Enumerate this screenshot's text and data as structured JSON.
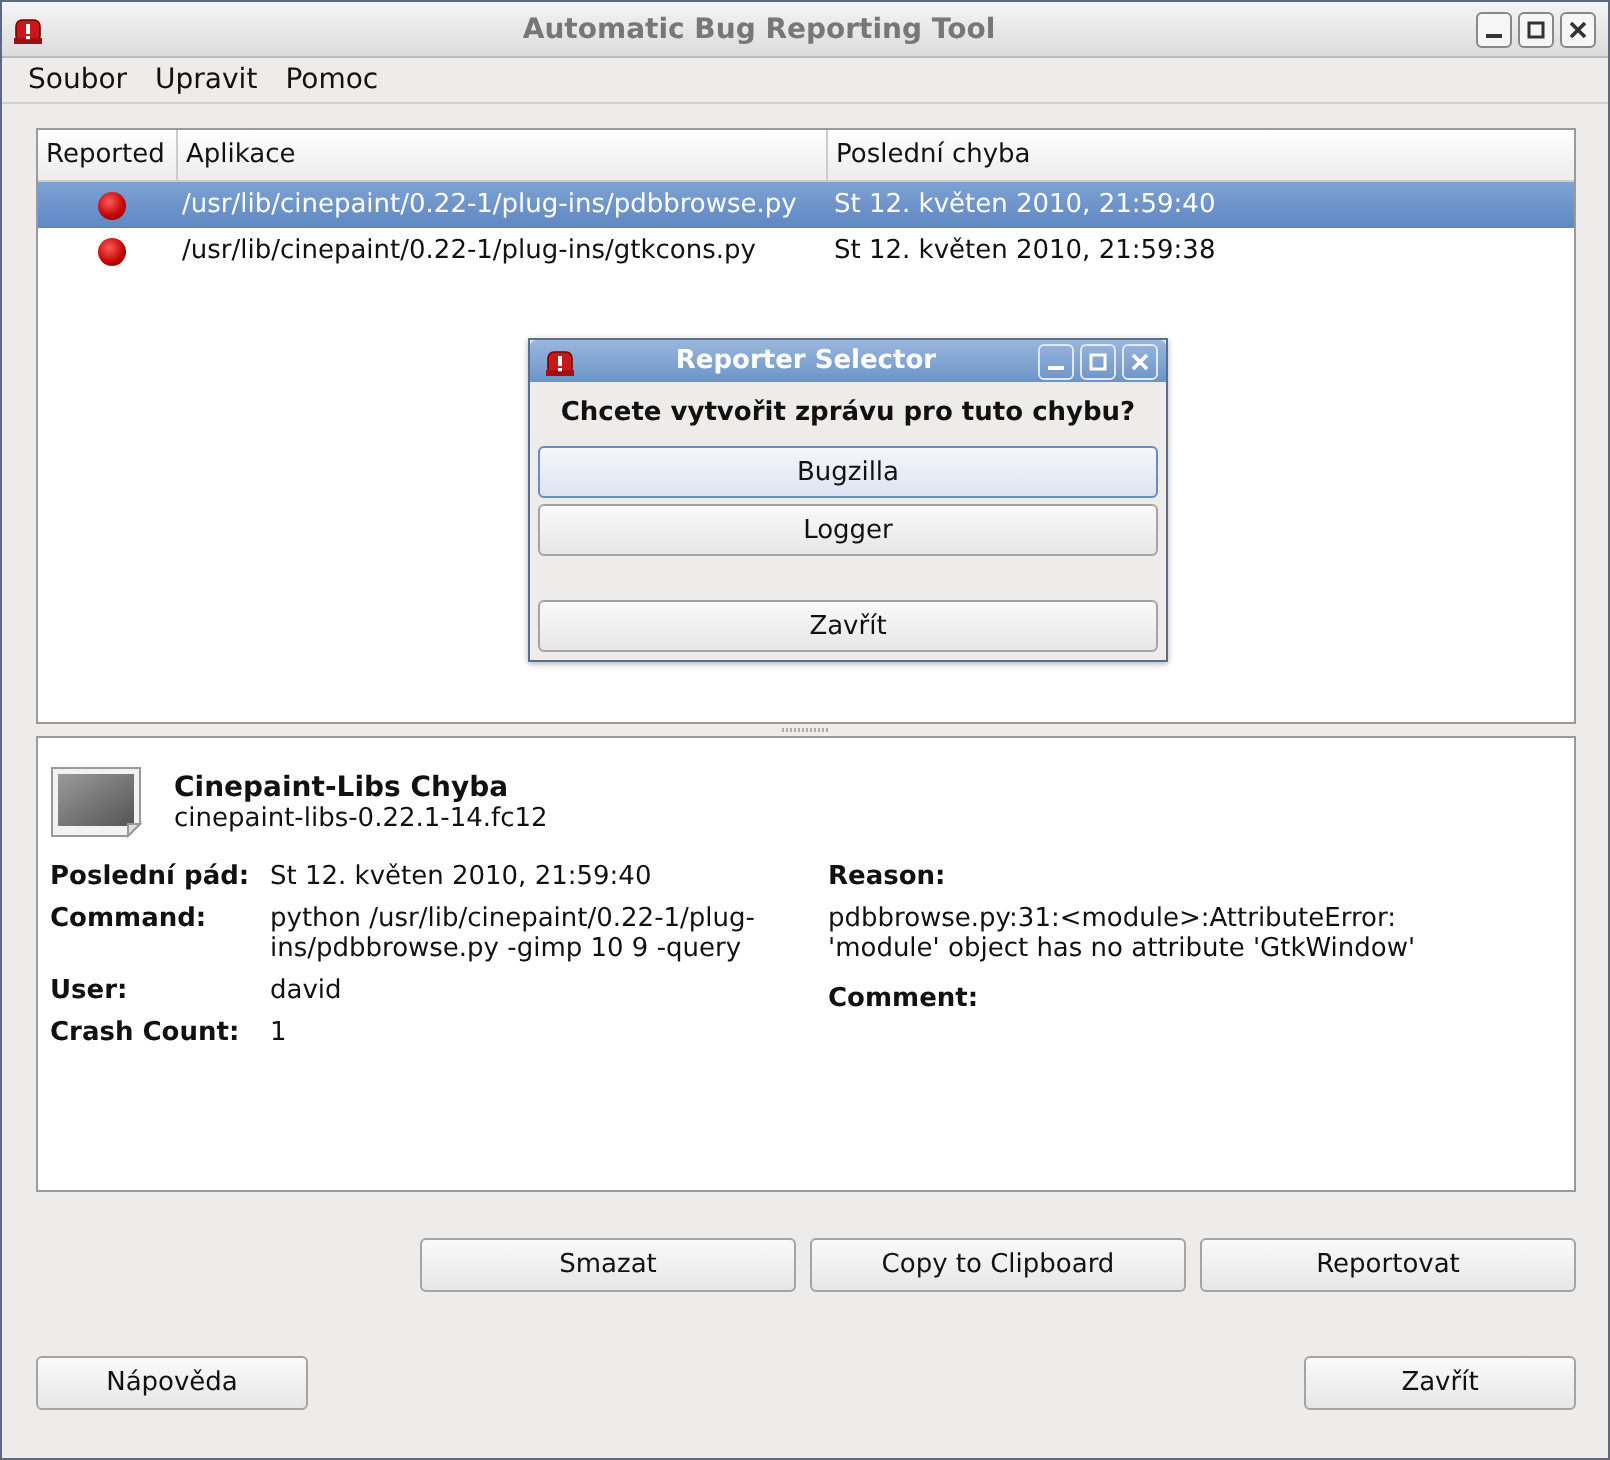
{
  "window": {
    "title": "Automatic Bug Reporting Tool"
  },
  "menu": [
    "Soubor",
    "Upravit",
    "Pomoc"
  ],
  "table": {
    "columns": [
      "Reported",
      "Aplikace",
      "Poslední chyba"
    ],
    "rows": [
      {
        "reported": false,
        "application": "/usr/lib/cinepaint/0.22-1/plug-ins/pdbbrowse.py",
        "last_crash": "St 12. květen 2010, 21:59:40",
        "selected": true
      },
      {
        "reported": false,
        "application": "/usr/lib/cinepaint/0.22-1/plug-ins/gtkcons.py",
        "last_crash": "St 12. květen 2010, 21:59:38",
        "selected": false
      }
    ]
  },
  "dialog": {
    "title": "Reporter Selector",
    "question": "Chcete vytvořit zprávu pro tuto chybu?",
    "options": [
      {
        "label": "Bugzilla",
        "focused": true
      },
      {
        "label": "Logger",
        "focused": false
      }
    ],
    "close_button": "Zavřít"
  },
  "details": {
    "name": "Cinepaint-Libs Chyba",
    "package": "cinepaint-libs-0.22.1-14.fc12",
    "left": [
      {
        "label": "Poslední pád:",
        "value": "St 12. květen 2010, 21:59:40"
      },
      {
        "label": "Command:",
        "value": "python /usr/lib/cinepaint/0.22-1/plug-ins/pdbbrowse.py -gimp 10 9 -query"
      },
      {
        "label": "User:",
        "value": "david"
      },
      {
        "label": "Crash Count:",
        "value": "1"
      }
    ],
    "right": [
      {
        "label": "Reason:",
        "value": "pdbbrowse.py:31:<module>:AttributeError: 'module' object has no attribute 'GtkWindow'"
      },
      {
        "label": "Comment:"
      }
    ]
  },
  "actions": [
    "Smazat",
    "Copy to Clipboard",
    "Reportovat"
  ],
  "footer": {
    "help": "Nápověda",
    "close": "Zavřít"
  }
}
